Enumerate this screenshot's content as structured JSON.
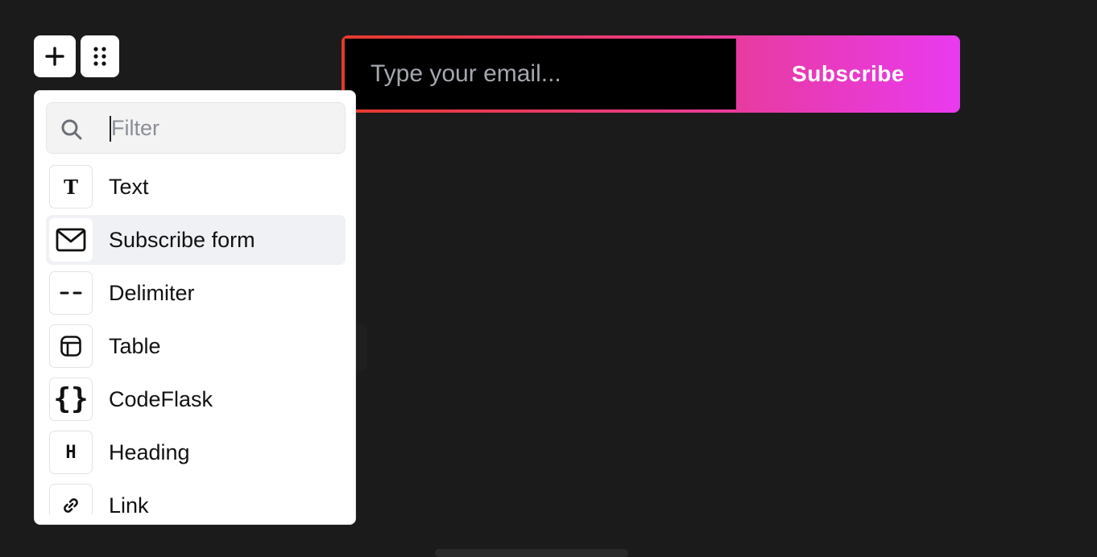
{
  "toolbar": {
    "add_icon": "plus-icon",
    "drag_icon": "drag-handle-icon"
  },
  "subscribe_form": {
    "email_placeholder": "Type your email...",
    "button_label": "Subscribe",
    "gradient_colors": [
      "#e63a2a",
      "#e83b8a",
      "#e93af0"
    ]
  },
  "block_menu": {
    "filter": {
      "placeholder": "Filter",
      "value": "",
      "icon": "search-icon"
    },
    "items": [
      {
        "label": "Text",
        "icon": "text-icon"
      },
      {
        "label": "Subscribe form",
        "icon": "mail-icon",
        "active": true
      },
      {
        "label": "Delimiter",
        "icon": "delimiter-icon"
      },
      {
        "label": "Table",
        "icon": "table-icon"
      },
      {
        "label": "CodeFlask",
        "icon": "code-braces-icon"
      },
      {
        "label": "Heading",
        "icon": "heading-icon"
      },
      {
        "label": "Link",
        "icon": "link-icon"
      }
    ]
  },
  "colors": {
    "background": "#1b1b1b",
    "menu_background": "#ffffff",
    "active_item": "#f0f1f5"
  }
}
